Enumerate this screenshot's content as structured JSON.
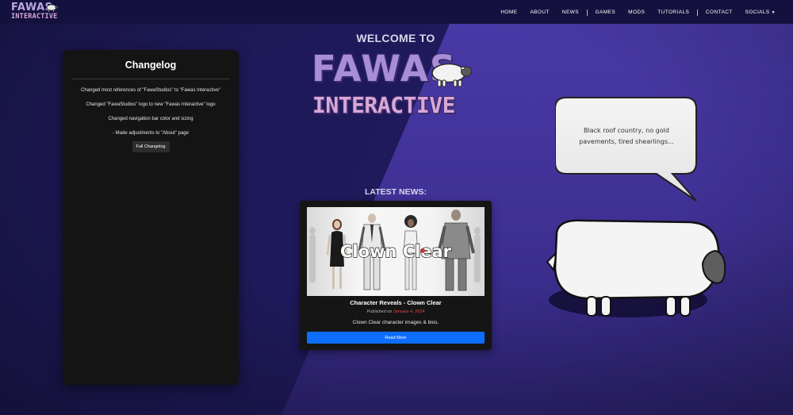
{
  "nav": {
    "logo_line1": "FAWAS",
    "logo_line2": "INTERACTIVE",
    "links": {
      "home": "HOME",
      "about": "ABOUT",
      "news": "NEWS",
      "games": "GAMES",
      "mods": "MODS",
      "tutorials": "TUTORIALS",
      "contact": "CONTACT",
      "socials": "SOCIALS"
    },
    "separator": "|"
  },
  "changelog": {
    "title": "Changelog",
    "items": [
      "Changed most references of \"FawaStudios\" to \"Fawas Interactive\"",
      "Changed \"FawaStudios\" logo to new \"Fawas Interactive\" logo",
      "Changed navigation bar color and sizing",
      "- Made adjustments to \"About\" page"
    ],
    "button_label": "Full Changelog"
  },
  "hero": {
    "welcome": "WELCOME TO",
    "logo_line1": "FAWAS",
    "logo_line2": "INTERACTIVE"
  },
  "news": {
    "heading": "LATEST NEWS:",
    "image_caption": "Clown Clear",
    "title": "Character Reveals - Clown Clear",
    "published_prefix": "Published on",
    "published_date": "January 4, 2024",
    "description": "Clown Clear character images & bios.",
    "button_label": "Read More"
  },
  "speech_bubble": {
    "line1": "Black roof country, no gold",
    "line2": "pavements, tired shearlings..."
  },
  "colors": {
    "nav_bg": "#15113f",
    "page_bg": "#2a2270",
    "diagonal_panel": "#4a3aa8",
    "logo_purple": "#a88ed6",
    "logo_pink": "#d8a8d8",
    "button_primary": "#0d6efd",
    "date_red": "#e04848"
  }
}
